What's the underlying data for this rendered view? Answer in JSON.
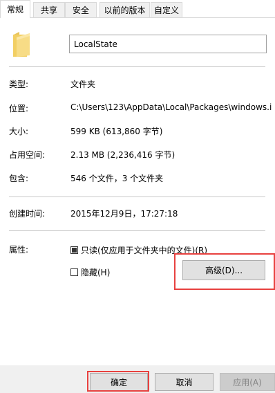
{
  "tabs": [
    "常规",
    "共享",
    "安全",
    "以前的版本",
    "自定义"
  ],
  "folder_name": "LocalState",
  "fields": {
    "type_label": "类型:",
    "type_value": "文件夹",
    "location_label": "位置:",
    "location_value": "C:\\Users\\123\\AppData\\Local\\Packages\\windows.i",
    "size_label": "大小:",
    "size_value": "599 KB (613,860 字节)",
    "disk_size_label": "占用空间:",
    "disk_size_value": "2.13 MB (2,236,416 字节)",
    "contains_label": "包含:",
    "contains_value": "546 个文件，3 个文件夹",
    "created_label": "创建时间:",
    "created_value": "2015年12月9日，17:27:18",
    "attributes_label": "属性:"
  },
  "attributes": {
    "readonly_label": "只读(仅应用于文件夹中的文件)(R)",
    "readonly_checked": true,
    "hidden_label": "隐藏(H)",
    "hidden_checked": false,
    "advanced_button": "高级(D)..."
  },
  "buttons": {
    "ok": "确定",
    "cancel": "取消",
    "apply": "应用(A)"
  },
  "colors": {
    "highlight": "#e8413f",
    "folder": "#f5d77a"
  },
  "icons": {
    "folder": "folder-icon"
  }
}
